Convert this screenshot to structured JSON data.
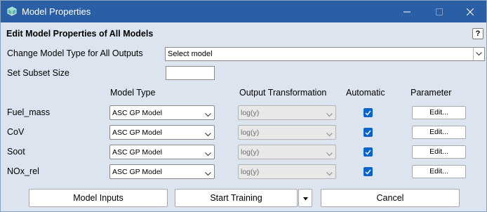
{
  "window": {
    "title": "Model Properties",
    "icon": "cube-app-icon",
    "controls": [
      "minimize-icon",
      "maximize-icon",
      "close-icon"
    ]
  },
  "header": {
    "title": "Edit Model Properties of All Models",
    "help_label": "?"
  },
  "global": {
    "change_type_label": "Change Model Type for All Outputs",
    "change_type_value": "Select model",
    "subset_label": "Set Subset Size",
    "subset_value": ""
  },
  "table": {
    "columns": {
      "model_type": "Model Type",
      "output_transformation": "Output Transformation",
      "automatic": "Automatic",
      "parameter": "Parameter"
    },
    "rows": [
      {
        "name": "Fuel_mass",
        "model_type": "ASC GP Model",
        "output_transformation": "log(y)",
        "automatic": true,
        "parameter_label": "Edit..."
      },
      {
        "name": "CoV",
        "model_type": "ASC GP Model",
        "output_transformation": "log(y)",
        "automatic": true,
        "parameter_label": "Edit..."
      },
      {
        "name": "Soot",
        "model_type": "ASC GP Model",
        "output_transformation": "log(y)",
        "automatic": true,
        "parameter_label": "Edit..."
      },
      {
        "name": "NOx_rel",
        "model_type": "ASC GP Model",
        "output_transformation": "log(y)",
        "automatic": true,
        "parameter_label": "Edit..."
      }
    ]
  },
  "footer": {
    "model_inputs_label": "Model Inputs",
    "start_training_label": "Start Training",
    "cancel_label": "Cancel"
  },
  "colors": {
    "titlebar": "#2a5fa5",
    "dialog_bg": "#dbe4ef",
    "checkbox": "#0a64c8"
  }
}
